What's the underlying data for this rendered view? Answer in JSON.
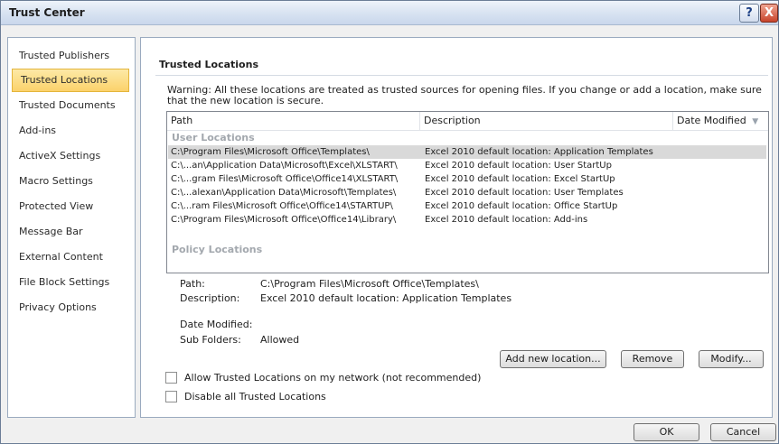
{
  "window": {
    "title": "Trust Center",
    "help": "?",
    "close": "X"
  },
  "sidebar": {
    "items": [
      {
        "label": "Trusted Publishers"
      },
      {
        "label": "Trusted Locations"
      },
      {
        "label": "Trusted Documents"
      },
      {
        "label": "Add-ins"
      },
      {
        "label": "ActiveX Settings"
      },
      {
        "label": "Macro Settings"
      },
      {
        "label": "Protected View"
      },
      {
        "label": "Message Bar"
      },
      {
        "label": "External Content"
      },
      {
        "label": "File Block Settings"
      },
      {
        "label": "Privacy Options"
      }
    ],
    "selected": "Trusted Locations"
  },
  "main": {
    "section_title": "Trusted Locations",
    "warning": "Warning: All these locations are treated as trusted sources for opening files.  If you change or add a location, make sure that the new location is secure.",
    "table": {
      "columns": [
        "Path",
        "Description",
        "Date Modified"
      ],
      "sort_indicator": "▼",
      "user_group": "User Locations",
      "policy_group": "Policy Locations",
      "rows": [
        {
          "path": "C:\\Program Files\\Microsoft Office\\Templates\\",
          "desc": "Excel 2010 default location: Application Templates"
        },
        {
          "path": "C:\\...an\\Application Data\\Microsoft\\Excel\\XLSTART\\",
          "desc": "Excel 2010 default location: User StartUp"
        },
        {
          "path": "C:\\...gram Files\\Microsoft Office\\Office14\\XLSTART\\",
          "desc": "Excel 2010 default location: Excel StartUp"
        },
        {
          "path": "C:\\...alexan\\Application Data\\Microsoft\\Templates\\",
          "desc": "Excel 2010 default location: User Templates"
        },
        {
          "path": "C:\\...ram Files\\Microsoft Office\\Office14\\STARTUP\\",
          "desc": "Excel 2010 default location: Office StartUp"
        },
        {
          "path": "C:\\Program Files\\Microsoft Office\\Office14\\Library\\",
          "desc": "Excel 2010 default location: Add-ins"
        }
      ]
    },
    "details": {
      "path_label": "Path:",
      "path_value": "C:\\Program Files\\Microsoft Office\\Templates\\",
      "desc_label": "Description:",
      "desc_value": "Excel 2010 default location: Application Templates",
      "date_label": "Date Modified:",
      "subfolders_label": "Sub Folders:",
      "subfolders_value": "Allowed"
    },
    "buttons": {
      "add": "Add new location...",
      "remove": "Remove",
      "modify": "Modify..."
    },
    "checkboxes": {
      "allow_network": "Allow Trusted Locations on my network (not recommended)",
      "disable_all": "Disable all Trusted Locations"
    }
  },
  "footer": {
    "ok": "OK",
    "cancel": "Cancel"
  }
}
